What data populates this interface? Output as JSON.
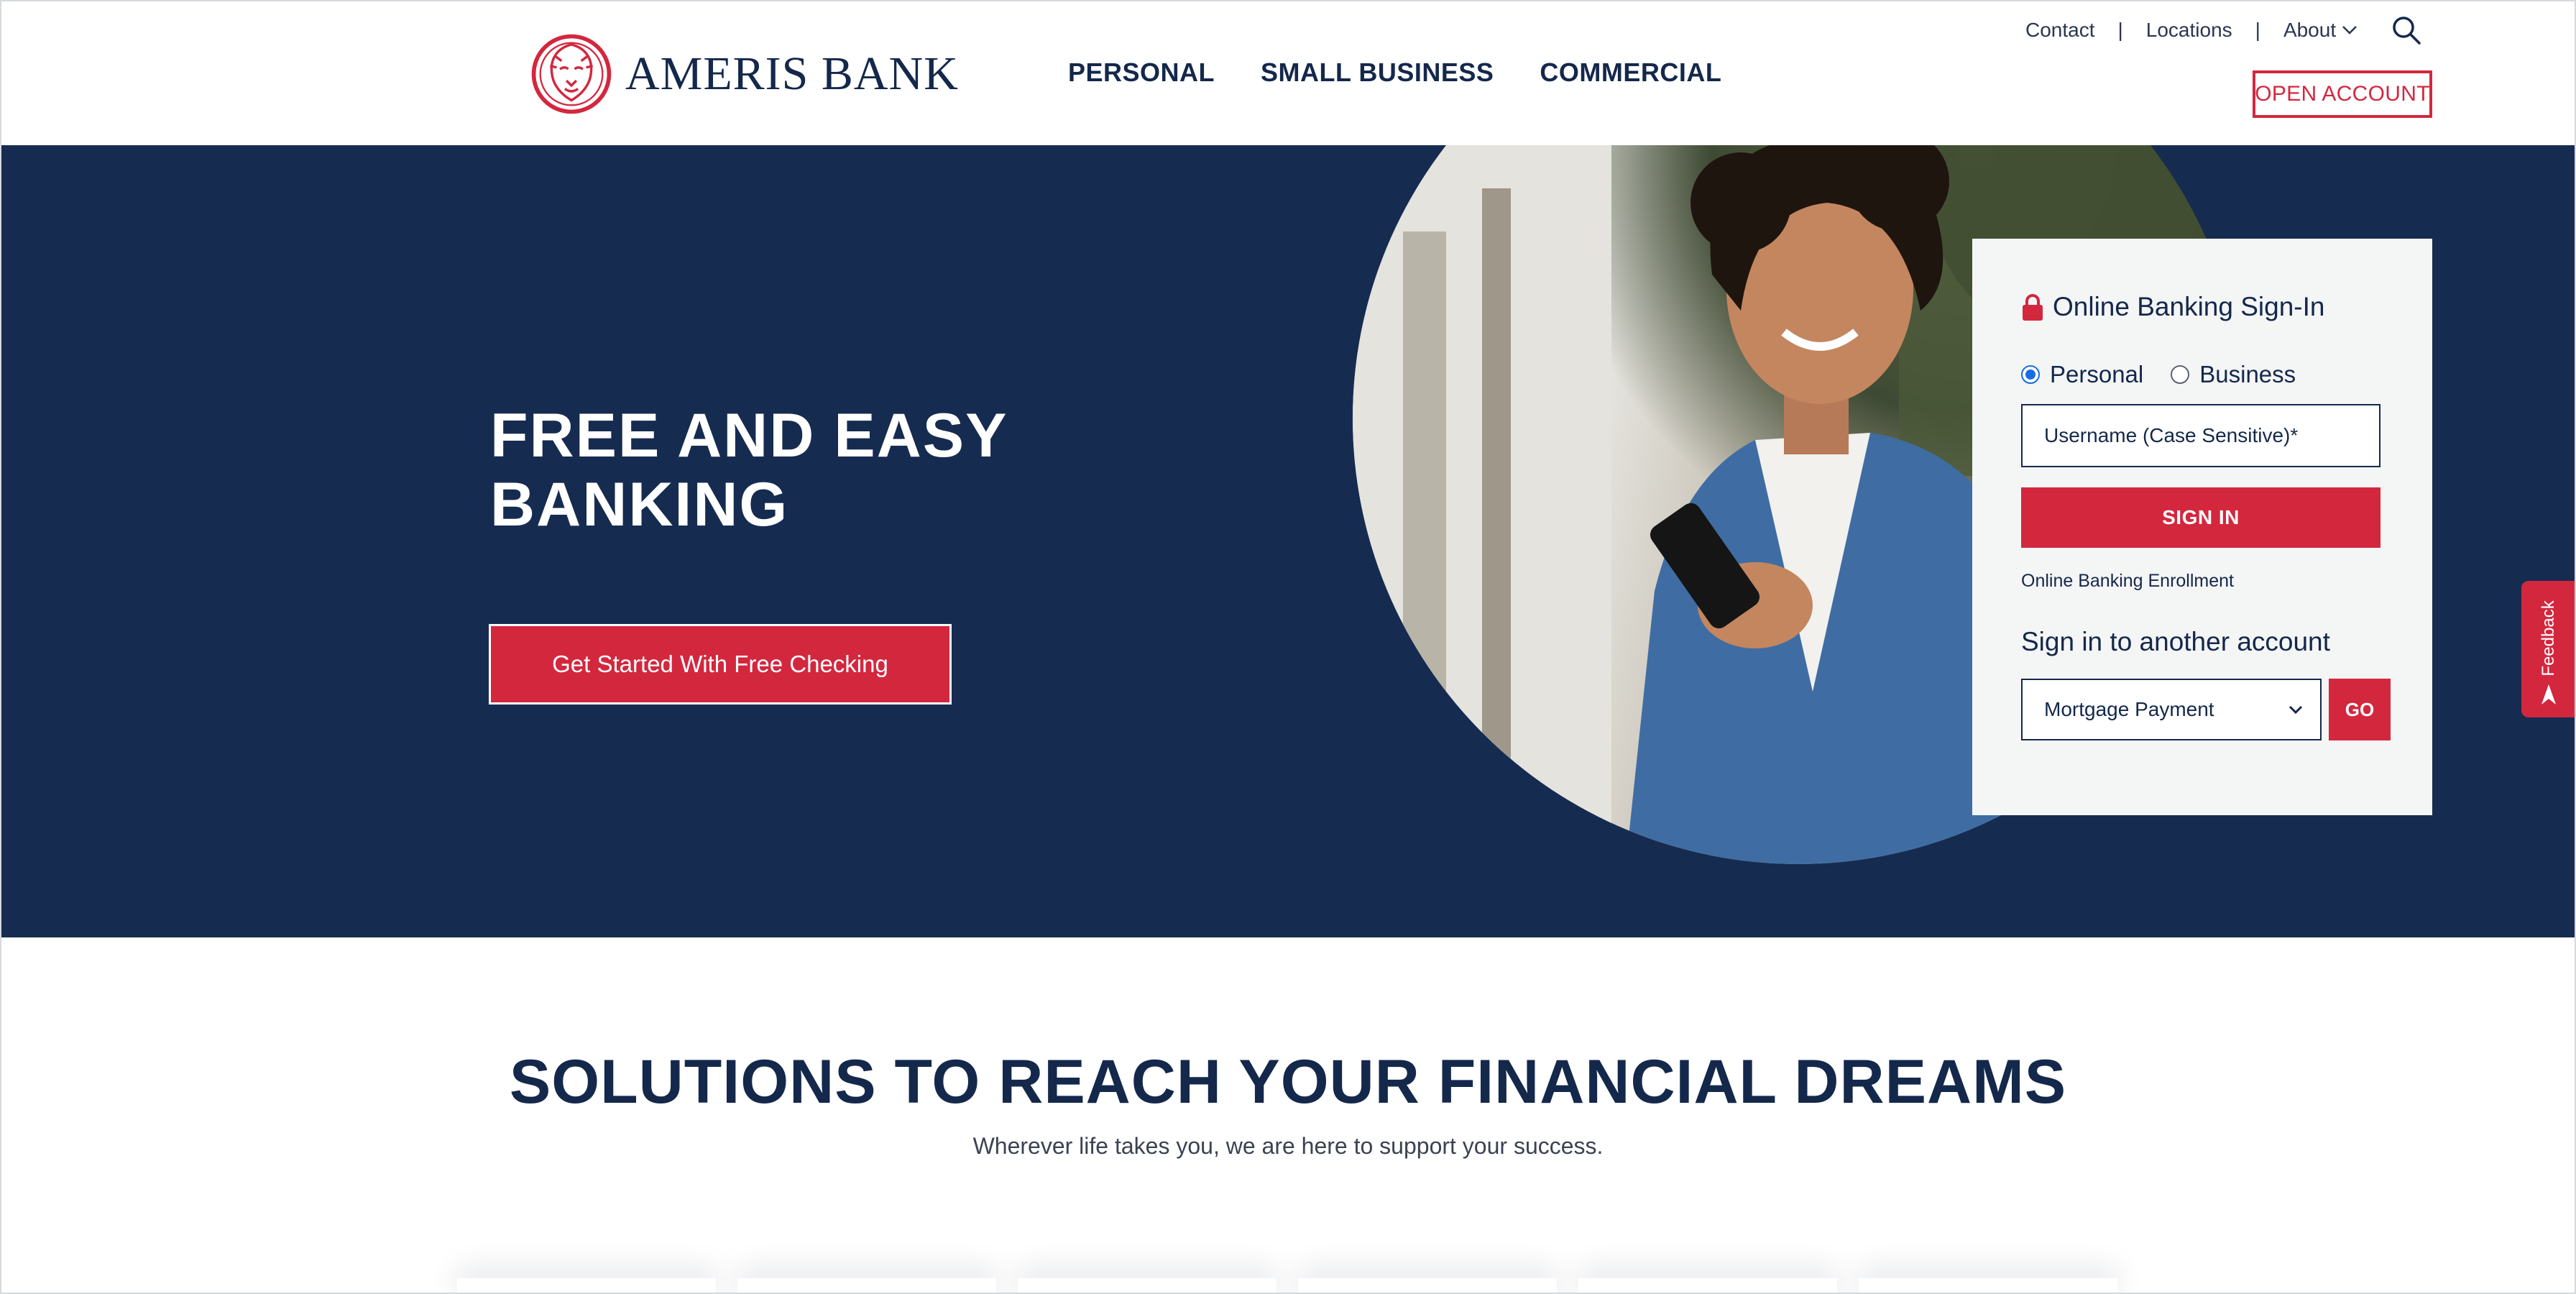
{
  "brand": {
    "name": "AMERIS BANK",
    "accent": "#d3273e",
    "navy": "#162b50"
  },
  "main_nav": {
    "personal": "PERSONAL",
    "small_business": "SMALL BUSINESS",
    "commercial": "COMMERCIAL"
  },
  "util_nav": {
    "contact": "Contact",
    "locations": "Locations",
    "about": "About",
    "separator": "|"
  },
  "header": {
    "open_account": "OPEN ACCOUNT"
  },
  "icons": {
    "search": "search-icon",
    "chevron": "chevron-down-icon",
    "lock": "lock-icon",
    "feedback": "feedback-icon"
  },
  "hero": {
    "title_line1": "FREE AND EASY",
    "title_line2": "BANKING",
    "cta": "Get Started With Free Checking"
  },
  "signin": {
    "title": "Online Banking Sign-In",
    "radio_personal": "Personal",
    "radio_business": "Business",
    "selected_account_type": "Personal",
    "username_placeholder": "Username (Case Sensitive)*",
    "sign_in_button": "SIGN IN",
    "enrollment_link": "Online Banking Enrollment",
    "another_heading": "Sign in to another account",
    "account_select_value": "Mortgage Payment",
    "go_button": "GO"
  },
  "feedback": {
    "label": "Feedback"
  },
  "solutions": {
    "title": "SOLUTIONS TO REACH YOUR FINANCIAL DREAMS",
    "subtitle": "Wherever life takes you, we are here to support your success."
  }
}
